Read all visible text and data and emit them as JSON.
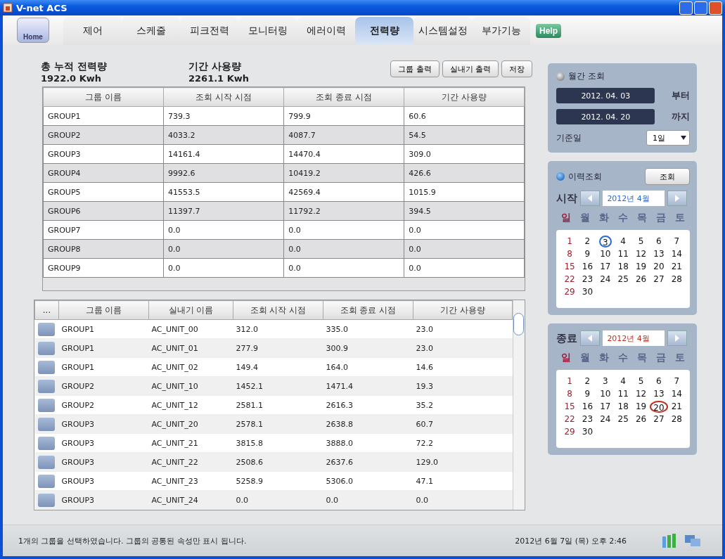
{
  "window": {
    "title": "V-net ACS"
  },
  "home": "Home",
  "help": "Help",
  "tabs": [
    {
      "label": "제어",
      "selected": false
    },
    {
      "label": "스케줄",
      "selected": false
    },
    {
      "label": "피크전력",
      "selected": false
    },
    {
      "label": "모니터링",
      "selected": false
    },
    {
      "label": "에러이력",
      "selected": false
    },
    {
      "label": "전력량",
      "selected": true
    },
    {
      "label": "시스템설정",
      "selected": false
    },
    {
      "label": "부가기능",
      "selected": false
    }
  ],
  "summary": [
    {
      "label": "총 누적 전력량",
      "value": "1922.0  Kwh"
    },
    {
      "label": "기간 사용량",
      "value": "2261.1  Kwh"
    }
  ],
  "buttons": [
    "그룹 출력",
    "실내기 출력",
    "저장"
  ],
  "group_table": {
    "columns": [
      "그룹 이름",
      "조회 시작 시점",
      "조회 종료 시점",
      "기간 사용량"
    ],
    "rows": [
      [
        "GROUP1",
        "739.3",
        "799.9",
        "60.6"
      ],
      [
        "GROUP2",
        "4033.2",
        "4087.7",
        "54.5"
      ],
      [
        "GROUP3",
        "14161.4",
        "14470.4",
        "309.0"
      ],
      [
        "GROUP4",
        "9992.6",
        "10419.2",
        "426.6"
      ],
      [
        "GROUP5",
        "41553.5",
        "42569.4",
        "1015.9"
      ],
      [
        "GROUP6",
        "11397.7",
        "11792.2",
        "394.5"
      ],
      [
        "GROUP7",
        "0.0",
        "0.0",
        "0.0"
      ],
      [
        "GROUP8",
        "0.0",
        "0.0",
        "0.0"
      ],
      [
        "GROUP9",
        "0.0",
        "0.0",
        "0.0"
      ]
    ]
  },
  "unit_table": {
    "columns": [
      "...",
      "그룹 이름",
      "실내기 이름",
      "조회 시작 시점",
      "조회 종료 시점",
      "기간 사용량"
    ],
    "rows": [
      [
        "",
        "GROUP1",
        "AC_UNIT_00",
        "312.0",
        "335.0",
        "23.0"
      ],
      [
        "",
        "GROUP1",
        "AC_UNIT_01",
        "277.9",
        "300.9",
        "23.0"
      ],
      [
        "",
        "GROUP1",
        "AC_UNIT_02",
        "149.4",
        "164.0",
        "14.6"
      ],
      [
        "",
        "GROUP2",
        "AC_UNIT_10",
        "1452.1",
        "1471.4",
        "19.3"
      ],
      [
        "",
        "GROUP2",
        "AC_UNIT_12",
        "2581.1",
        "2616.3",
        "35.2"
      ],
      [
        "",
        "GROUP3",
        "AC_UNIT_20",
        "2578.1",
        "2638.8",
        "60.7"
      ],
      [
        "",
        "GROUP3",
        "AC_UNIT_21",
        "3815.8",
        "3888.0",
        "72.2"
      ],
      [
        "",
        "GROUP3",
        "AC_UNIT_22",
        "2508.6",
        "2637.6",
        "129.0"
      ],
      [
        "",
        "GROUP3",
        "AC_UNIT_23",
        "5258.9",
        "5306.0",
        "47.1"
      ],
      [
        "",
        "GROUP3",
        "AC_UNIT_24",
        "0.0",
        "0.0",
        "0.0"
      ]
    ]
  },
  "monthly": {
    "radio": {
      "label": "월간 조회",
      "selected": false
    },
    "from": {
      "value": "2012. 04. 03",
      "suffix": "부터"
    },
    "to": {
      "value": "2012. 04. 20",
      "suffix": "까지"
    },
    "base_day": {
      "label": "기준일",
      "value": "1일"
    }
  },
  "history": {
    "radio": {
      "label": "이력조회",
      "selected": true
    },
    "button": "조회",
    "calendars": [
      {
        "label": "시작",
        "month": "2012년 4월",
        "color": "#2a6ad0",
        "weekdays": [
          "일",
          "월",
          "화",
          "수",
          "목",
          "금",
          "토"
        ],
        "days": [
          {
            "day": "1",
            "selected": false
          },
          {
            "day": "2",
            "selected": false
          },
          {
            "day": "3",
            "selected": true
          },
          {
            "day": "4",
            "selected": false
          },
          {
            "day": "5",
            "selected": false
          },
          {
            "day": "6",
            "selected": false
          },
          {
            "day": "7",
            "selected": false
          },
          {
            "day": "8",
            "selected": false
          },
          {
            "day": "9",
            "selected": false
          },
          {
            "day": "10",
            "selected": false
          },
          {
            "day": "11",
            "selected": false
          },
          {
            "day": "12",
            "selected": false
          },
          {
            "day": "13",
            "selected": false
          },
          {
            "day": "14",
            "selected": false
          },
          {
            "day": "15",
            "selected": false
          },
          {
            "day": "16",
            "selected": false
          },
          {
            "day": "17",
            "selected": false
          },
          {
            "day": "18",
            "selected": false
          },
          {
            "day": "19",
            "selected": false
          },
          {
            "day": "20",
            "selected": false
          },
          {
            "day": "21",
            "selected": false
          },
          {
            "day": "22",
            "selected": false
          },
          {
            "day": "23",
            "selected": false
          },
          {
            "day": "24",
            "selected": false
          },
          {
            "day": "25",
            "selected": false
          },
          {
            "day": "26",
            "selected": false
          },
          {
            "day": "27",
            "selected": false
          },
          {
            "day": "28",
            "selected": false
          },
          {
            "day": "29",
            "selected": false
          },
          {
            "day": "30",
            "selected": false
          }
        ]
      },
      {
        "label": "종료",
        "month": "2012년 4월",
        "color": "#c03020",
        "weekdays": [
          "일",
          "월",
          "화",
          "수",
          "목",
          "금",
          "토"
        ],
        "days": [
          {
            "day": "1",
            "selected": false
          },
          {
            "day": "2",
            "selected": false
          },
          {
            "day": "3",
            "selected": false
          },
          {
            "day": "4",
            "selected": false
          },
          {
            "day": "5",
            "selected": false
          },
          {
            "day": "6",
            "selected": false
          },
          {
            "day": "7",
            "selected": false
          },
          {
            "day": "8",
            "selected": false
          },
          {
            "day": "9",
            "selected": false
          },
          {
            "day": "10",
            "selected": false
          },
          {
            "day": "11",
            "selected": false
          },
          {
            "day": "12",
            "selected": false
          },
          {
            "day": "13",
            "selected": false
          },
          {
            "day": "14",
            "selected": false
          },
          {
            "day": "15",
            "selected": false
          },
          {
            "day": "16",
            "selected": false
          },
          {
            "day": "17",
            "selected": false
          },
          {
            "day": "18",
            "selected": false
          },
          {
            "day": "19",
            "selected": false
          },
          {
            "day": "20",
            "selected": true
          },
          {
            "day": "21",
            "selected": false
          },
          {
            "day": "22",
            "selected": false
          },
          {
            "day": "23",
            "selected": false
          },
          {
            "day": "24",
            "selected": false
          },
          {
            "day": "25",
            "selected": false
          },
          {
            "day": "26",
            "selected": false
          },
          {
            "day": "27",
            "selected": false
          },
          {
            "day": "28",
            "selected": false
          },
          {
            "day": "29",
            "selected": false
          },
          {
            "day": "30",
            "selected": false
          }
        ]
      }
    ]
  },
  "status_bar": {
    "message": "1개의 그룹을 선택하였습니다. 그룹의 공통된 속성만 표시 됩니다.",
    "datetime": "2012년 6월 7일 (목) 오후 2:46"
  }
}
